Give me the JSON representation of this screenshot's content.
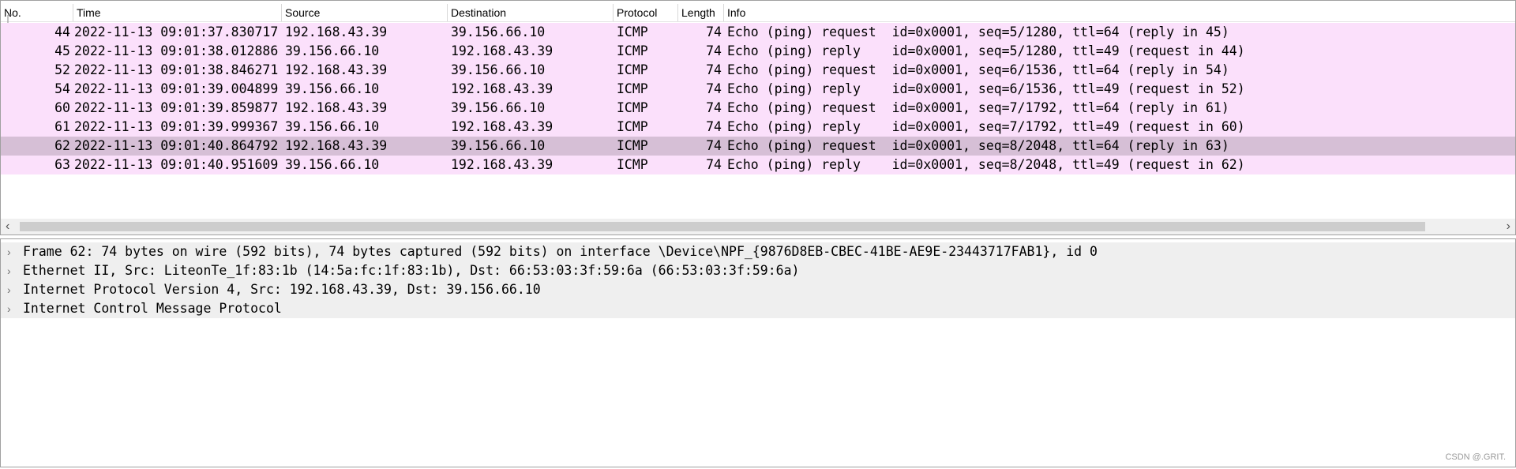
{
  "columns": {
    "no": "No.",
    "time": "Time",
    "source": "Source",
    "destination": "Destination",
    "protocol": "Protocol",
    "length": "Length",
    "info": "Info"
  },
  "packets": [
    {
      "no": "44",
      "time": "2022-11-13 09:01:37.830717",
      "source": "192.168.43.39",
      "destination": "39.156.66.10",
      "protocol": "ICMP",
      "length": "74",
      "info": "Echo (ping) request  id=0x0001, seq=5/1280, ttl=64 (reply in 45)"
    },
    {
      "no": "45",
      "time": "2022-11-13 09:01:38.012886",
      "source": "39.156.66.10",
      "destination": "192.168.43.39",
      "protocol": "ICMP",
      "length": "74",
      "info": "Echo (ping) reply    id=0x0001, seq=5/1280, ttl=49 (request in 44)"
    },
    {
      "no": "52",
      "time": "2022-11-13 09:01:38.846271",
      "source": "192.168.43.39",
      "destination": "39.156.66.10",
      "protocol": "ICMP",
      "length": "74",
      "info": "Echo (ping) request  id=0x0001, seq=6/1536, ttl=64 (reply in 54)"
    },
    {
      "no": "54",
      "time": "2022-11-13 09:01:39.004899",
      "source": "39.156.66.10",
      "destination": "192.168.43.39",
      "protocol": "ICMP",
      "length": "74",
      "info": "Echo (ping) reply    id=0x0001, seq=6/1536, ttl=49 (request in 52)"
    },
    {
      "no": "60",
      "time": "2022-11-13 09:01:39.859877",
      "source": "192.168.43.39",
      "destination": "39.156.66.10",
      "protocol": "ICMP",
      "length": "74",
      "info": "Echo (ping) request  id=0x0001, seq=7/1792, ttl=64 (reply in 61)"
    },
    {
      "no": "61",
      "time": "2022-11-13 09:01:39.999367",
      "source": "39.156.66.10",
      "destination": "192.168.43.39",
      "protocol": "ICMP",
      "length": "74",
      "info": "Echo (ping) reply    id=0x0001, seq=7/1792, ttl=49 (request in 60)"
    },
    {
      "no": "62",
      "time": "2022-11-13 09:01:40.864792",
      "source": "192.168.43.39",
      "destination": "39.156.66.10",
      "protocol": "ICMP",
      "length": "74",
      "info": "Echo (ping) request  id=0x0001, seq=8/2048, ttl=64 (reply in 63)",
      "selected": true
    },
    {
      "no": "63",
      "time": "2022-11-13 09:01:40.951609",
      "source": "39.156.66.10",
      "destination": "192.168.43.39",
      "protocol": "ICMP",
      "length": "74",
      "info": "Echo (ping) reply    id=0x0001, seq=8/2048, ttl=49 (request in 62)"
    }
  ],
  "details": [
    {
      "text": "Frame 62: 74 bytes on wire (592 bits), 74 bytes captured (592 bits) on interface \\Device\\NPF_{9876D8EB-CBEC-41BE-AE9E-23443717FAB1}, id 0",
      "icon": "chevron-right-icon"
    },
    {
      "text": "Ethernet II, Src: LiteonTe_1f:83:1b (14:5a:fc:1f:83:1b), Dst: 66:53:03:3f:59:6a (66:53:03:3f:59:6a)",
      "icon": "chevron-right-icon"
    },
    {
      "text": "Internet Protocol Version 4, Src: 192.168.43.39, Dst: 39.156.66.10",
      "icon": "chevron-right-icon"
    },
    {
      "text": "Internet Control Message Protocol",
      "icon": "chevron-right-icon"
    }
  ],
  "colors": {
    "icmp_row": "#fbe0fb",
    "selected_row": "#d6bfd6",
    "detail_bg": "#efefef"
  },
  "watermark": "CSDN @.GRIT."
}
